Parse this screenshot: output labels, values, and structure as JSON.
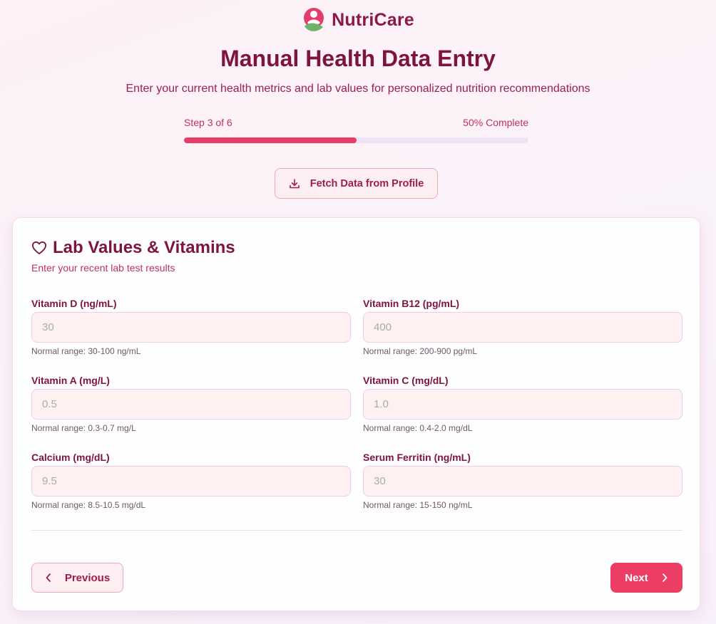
{
  "brand": {
    "name": "NutriCare"
  },
  "header": {
    "title": "Manual Health Data Entry",
    "subtitle": "Enter your current health metrics and lab values for personalized nutrition recommendations"
  },
  "progress": {
    "step_label": "Step 3 of 6",
    "percent_label": "50% Complete",
    "fraction": 0.5
  },
  "fetch_button": {
    "label": "Fetch Data from Profile",
    "icon": "download-icon"
  },
  "card": {
    "title": "Lab Values & Vitamins",
    "title_icon": "heart-icon",
    "subtitle": "Enter your recent lab test results"
  },
  "fields": [
    {
      "label": "Vitamin D (ng/mL)",
      "placeholder": "30",
      "value": "",
      "hint": "Normal range: 30-100 ng/mL"
    },
    {
      "label": "Vitamin B12 (pg/mL)",
      "placeholder": "400",
      "value": "",
      "hint": "Normal range: 200-900 pg/mL"
    },
    {
      "label": "Vitamin A (mg/L)",
      "placeholder": "0.5",
      "value": "",
      "hint": "Normal range: 0.3-0.7 mg/L"
    },
    {
      "label": "Vitamin C (mg/dL)",
      "placeholder": "1.0",
      "value": "",
      "hint": "Normal range: 0.4-2.0 mg/dL"
    },
    {
      "label": "Calcium (mg/dL)",
      "placeholder": "9.5",
      "value": "",
      "hint": "Normal range: 8.5-10.5 mg/dL"
    },
    {
      "label": "Serum Ferritin (ng/mL)",
      "placeholder": "30",
      "value": "",
      "hint": "Normal range: 15-150 ng/mL"
    }
  ],
  "nav": {
    "previous_label": "Previous",
    "previous_icon": "chevron-left-icon",
    "next_label": "Next",
    "next_icon": "chevron-right-icon"
  },
  "colors": {
    "accent": "#ec3d64",
    "title": "#7d1440",
    "input_bg": "#fff0f2",
    "track": "#efe2f6"
  }
}
